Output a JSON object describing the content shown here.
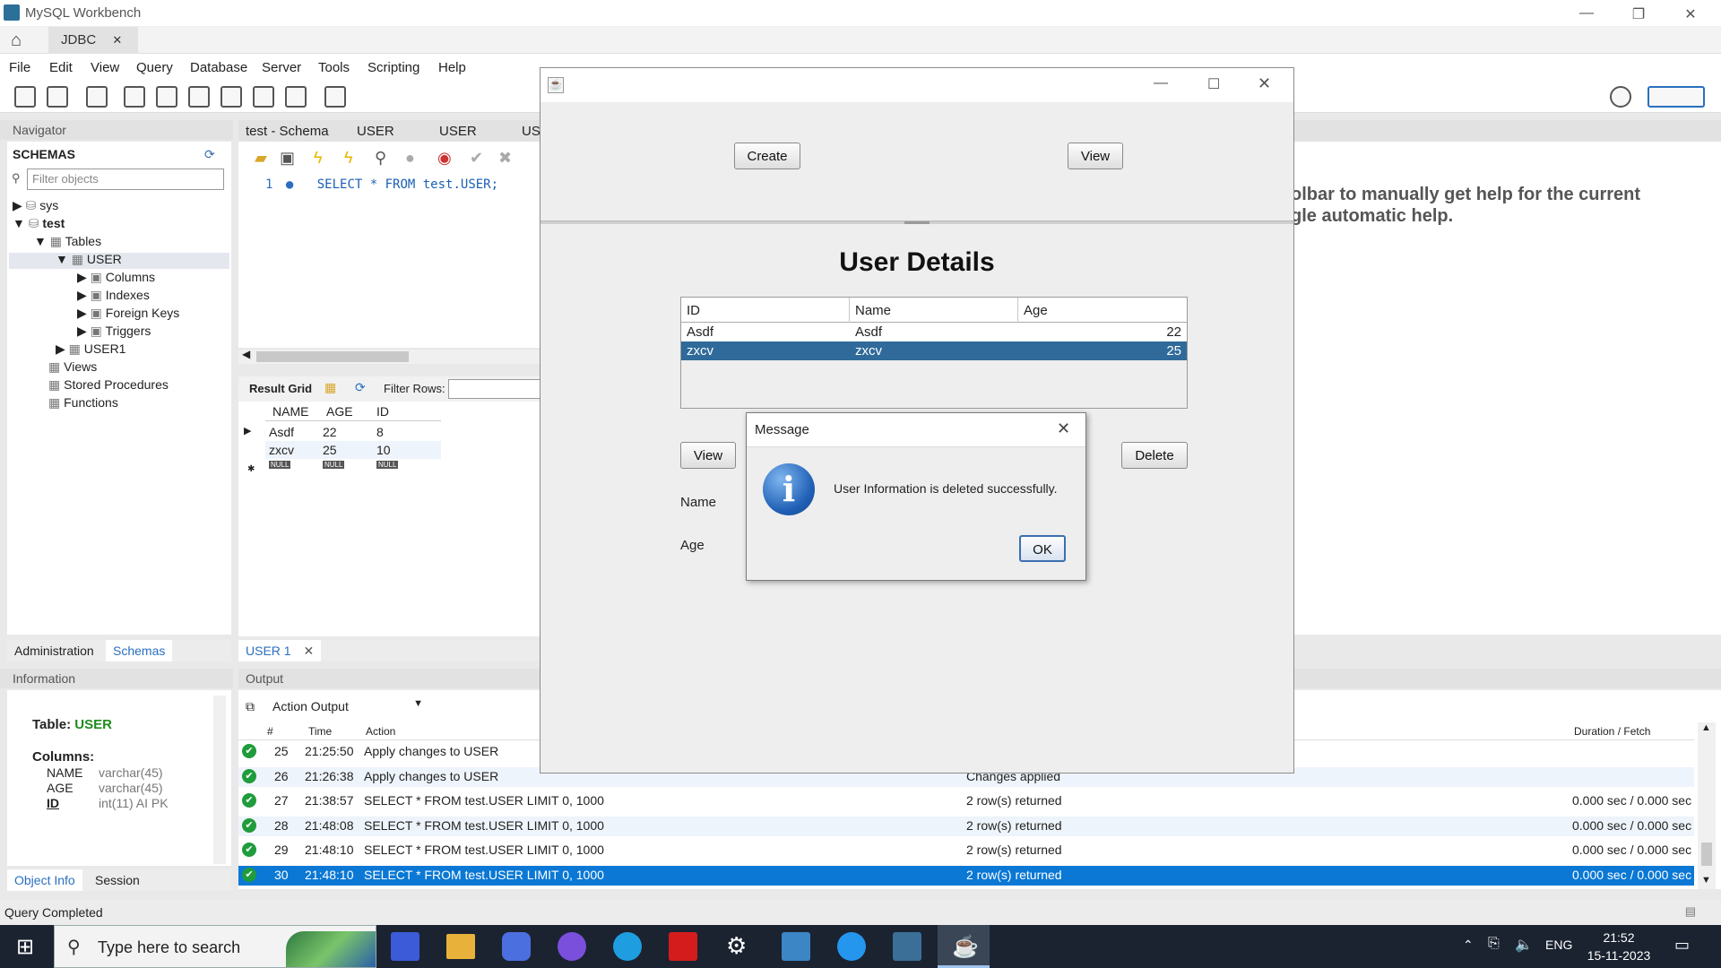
{
  "app": {
    "title": "MySQL Workbench",
    "connection_tab": "JDBC",
    "menus": [
      "File",
      "Edit",
      "View",
      "Query",
      "Database",
      "Server",
      "Tools",
      "Scripting",
      "Help"
    ]
  },
  "navigator": {
    "header": "Navigator",
    "schemas_label": "SCHEMAS",
    "filter_placeholder": "Filter objects",
    "tree": {
      "sys": "sys",
      "test": "test",
      "tables": "Tables",
      "user": "USER",
      "columns": "Columns",
      "indexes": "Indexes",
      "foreign_keys": "Foreign Keys",
      "triggers": "Triggers",
      "user1": "USER1",
      "views": "Views",
      "stored_procedures": "Stored Procedures",
      "functions": "Functions"
    },
    "tabs": {
      "administration": "Administration",
      "schemas": "Schemas"
    }
  },
  "information": {
    "header": "Information",
    "table_prefix": "Table:",
    "table_name": "USER",
    "columns_label": "Columns:",
    "columns": [
      {
        "name": "NAME",
        "type": "varchar(45)"
      },
      {
        "name": "AGE",
        "type": "varchar(45)"
      },
      {
        "name": "ID",
        "type": "int(11) AI PK"
      }
    ],
    "tabs": {
      "object_info": "Object Info",
      "session": "Session"
    }
  },
  "editor": {
    "tabs": [
      "test - Schema",
      "USER",
      "USER",
      "US"
    ],
    "line_no": "1",
    "sql": "SELECT * FROM test.USER;",
    "result_grid_label": "Result Grid",
    "filter_rows_label": "Filter Rows:",
    "grid_headers": [
      "NAME",
      "AGE",
      "ID"
    ],
    "grid_rows": [
      [
        "Asdf",
        "22",
        "8"
      ],
      [
        "zxcv",
        "25",
        "10"
      ]
    ],
    "null_label": "NULL",
    "result_tab": "USER 1"
  },
  "right_panel": {
    "help_line1": "olbar to manually get help for the current",
    "help_line2": "gle automatic help."
  },
  "output": {
    "header": "Output",
    "selector": "Action Output",
    "col_hash": "#",
    "col_time": "Time",
    "col_action": "Action",
    "col_duration": "Duration / Fetch",
    "rows": [
      {
        "n": "25",
        "time": "21:25:50",
        "action": "Apply changes to USER",
        "message": "",
        "duration": ""
      },
      {
        "n": "26",
        "time": "21:26:38",
        "action": "Apply changes to USER",
        "message": "Changes applied",
        "duration": ""
      },
      {
        "n": "27",
        "time": "21:38:57",
        "action": "SELECT * FROM test.USER LIMIT 0, 1000",
        "message": "2 row(s) returned",
        "duration": "0.000 sec / 0.000 sec"
      },
      {
        "n": "28",
        "time": "21:48:08",
        "action": "SELECT * FROM test.USER LIMIT 0, 1000",
        "message": "2 row(s) returned",
        "duration": "0.000 sec / 0.000 sec"
      },
      {
        "n": "29",
        "time": "21:48:10",
        "action": "SELECT * FROM test.USER LIMIT 0, 1000",
        "message": "2 row(s) returned",
        "duration": "0.000 sec / 0.000 sec"
      },
      {
        "n": "30",
        "time": "21:48:10",
        "action": "SELECT * FROM test.USER LIMIT 0, 1000",
        "message": "2 row(s) returned",
        "duration": "0.000 sec / 0.000 sec"
      }
    ]
  },
  "status_bar": "Query Completed",
  "java_app": {
    "create_label": "Create",
    "view_top_label": "View",
    "heading": "User Details",
    "table_headers": [
      "ID",
      "Name",
      "Age"
    ],
    "table_rows": [
      {
        "id": "Asdf",
        "name": "Asdf",
        "age": "22"
      },
      {
        "id": "zxcv",
        "name": "zxcv",
        "age": "25"
      }
    ],
    "view_label": "View",
    "delete_label": "Delete",
    "name_label": "Name",
    "age_label": "Age"
  },
  "message_dialog": {
    "title": "Message",
    "text": "User Information is deleted successfully.",
    "ok_label": "OK"
  },
  "taskbar": {
    "search_placeholder": "Type here to search",
    "language": "ENG",
    "time": "21:52",
    "date": "15-11-2023"
  },
  "colors": {
    "selection": "#2f6a9a",
    "output_selection": "#0a78d4",
    "taskbar": "#1b2331"
  }
}
